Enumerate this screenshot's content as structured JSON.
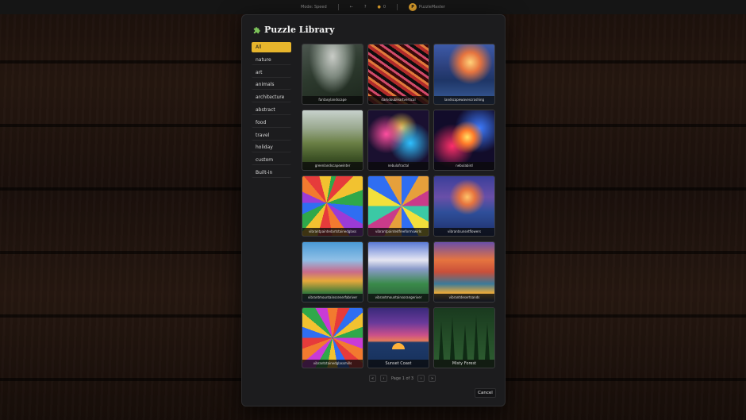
{
  "topbar": {
    "mode_label": "Mode: Speed",
    "ctl_a": "←",
    "ctl_b": "?",
    "pieces": "0",
    "logo_letter": "P",
    "brand": "PuzzleMaster"
  },
  "modal": {
    "title": "Puzzle Library",
    "icon": "puzzle-piece-icon"
  },
  "categories": [
    {
      "label": "All",
      "active": true
    },
    {
      "label": "nature"
    },
    {
      "label": "art"
    },
    {
      "label": "animals"
    },
    {
      "label": "architecture"
    },
    {
      "label": "abstract"
    },
    {
      "label": "food"
    },
    {
      "label": "travel"
    },
    {
      "label": "holiday"
    },
    {
      "label": "custom"
    },
    {
      "label": "Built-in"
    }
  ],
  "puzzles": [
    {
      "label": "fantasylandscape"
    },
    {
      "label": "darkdoubleartvertical"
    },
    {
      "label": "landscapewavescrashing"
    },
    {
      "label": "greenlandscapewinter"
    },
    {
      "label": "nebulafractal"
    },
    {
      "label": "nebulabird"
    },
    {
      "label": "vibrantpaintedartstainedglass"
    },
    {
      "label": "vibrantpaintedfreeformswirls"
    },
    {
      "label": "vibrantsunsetflowers"
    },
    {
      "label": "vibrantmountainscenerfabriver"
    },
    {
      "label": "vibrantmountainsorangeriver"
    },
    {
      "label": "vibrantdesertsands"
    },
    {
      "label": "vibrantstainedglassmills"
    },
    {
      "label": "Sunset Coast"
    },
    {
      "label": "Misty Forest"
    }
  ],
  "pagination": {
    "first": "«",
    "prev": "‹",
    "page_text": "Page 1 of 3",
    "next": "›",
    "last": "»"
  },
  "cancel_label": "Cancel",
  "colors": {
    "accent": "#e7b52c",
    "modal_bg": "#1c1c1e"
  }
}
